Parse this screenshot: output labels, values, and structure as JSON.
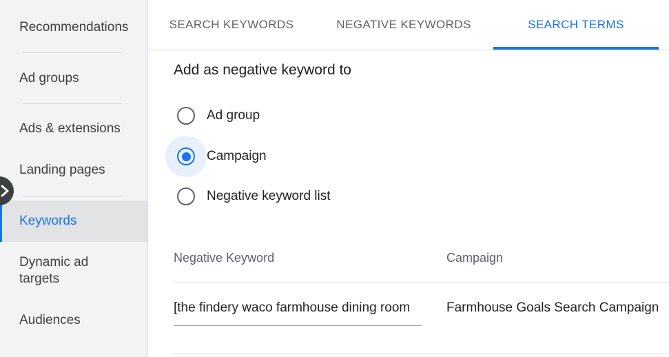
{
  "sidebar": {
    "items": [
      {
        "label": "Recommendations"
      },
      {
        "label": "Ad groups"
      },
      {
        "label": "Ads & extensions"
      },
      {
        "label": "Landing pages"
      },
      {
        "label": "Keywords"
      },
      {
        "label": "Dynamic ad targets"
      },
      {
        "label": "Audiences"
      }
    ],
    "active": "Keywords"
  },
  "tabs": [
    {
      "label": "SEARCH KEYWORDS"
    },
    {
      "label": "NEGATIVE KEYWORDS"
    },
    {
      "label": "SEARCH TERMS"
    }
  ],
  "active_tab": "SEARCH TERMS",
  "form": {
    "title": "Add as negative keyword to",
    "options": [
      {
        "label": "Ad group",
        "checked": false
      },
      {
        "label": "Campaign",
        "checked": true
      },
      {
        "label": "Negative keyword list",
        "checked": false
      }
    ]
  },
  "table": {
    "headers": [
      "Negative Keyword",
      "Campaign"
    ],
    "rows": [
      {
        "keyword": "[the findery waco farmhouse dining room",
        "campaign": "Farmhouse Goals Search Campaign"
      }
    ]
  },
  "colors": {
    "accent": "#1a73e8",
    "sidebar_bg": "#f1f3f4"
  },
  "icons": {
    "collapse": "chevron-right-icon"
  }
}
